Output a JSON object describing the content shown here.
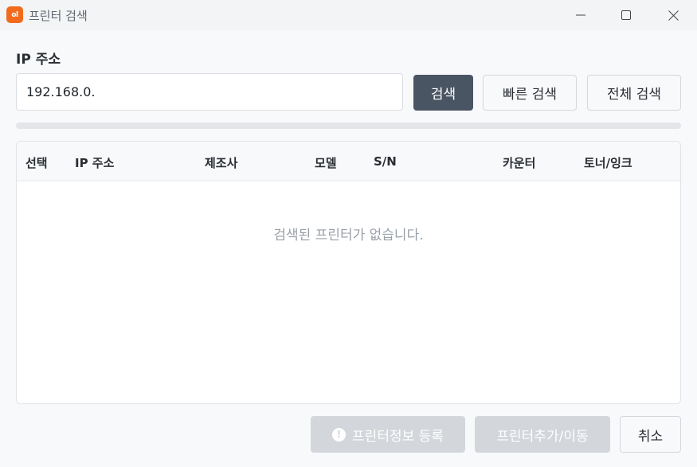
{
  "window": {
    "title": "프린터 검색",
    "app_icon_text": "ol",
    "controls": [
      "minimize-icon",
      "maximize-icon",
      "close-icon"
    ]
  },
  "search": {
    "label": "IP 주소",
    "ip_value": "192.168.0.",
    "search_label": "검색",
    "quick_search_label": "빠른 검색",
    "full_search_label": "전체 검색",
    "progress": 0
  },
  "table": {
    "columns": [
      "선택",
      "IP 주소",
      "제조사",
      "모델",
      "S/N",
      "카운터",
      "토너/잉크"
    ],
    "rows": [],
    "empty_message": "검색된 프린터가 없습니다."
  },
  "footer": {
    "register_label": "프린터정보 등록",
    "add_move_label": "프린터추가/이동",
    "cancel_label": "취소"
  },
  "colors": {
    "accent": "#4a5563",
    "app_icon": "#f26b1d",
    "disabled": "#d3d6db"
  }
}
